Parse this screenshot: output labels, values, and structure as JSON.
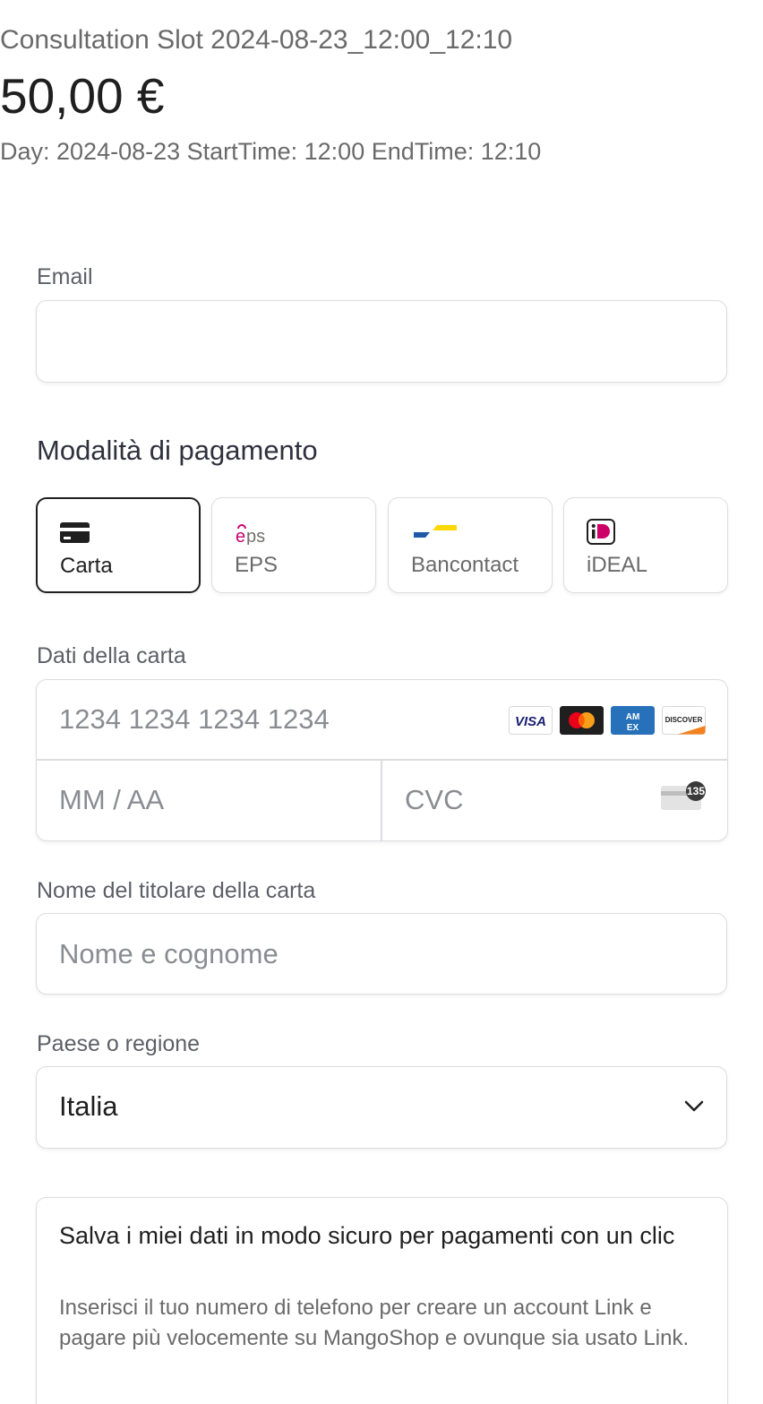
{
  "header": {
    "product_name": "Consultation Slot 2024-08-23_12:00_12:10",
    "price": "50,00 €",
    "description": "Day: 2024-08-23 StartTime: 12:00 EndTime: 12:10"
  },
  "email": {
    "label": "Email",
    "value": ""
  },
  "payment_method": {
    "title": "Modalità di pagamento",
    "selected": "Carta",
    "tabs": [
      {
        "label": "Carta",
        "icon": "card-icon"
      },
      {
        "label": "EPS",
        "icon": "eps-logo-icon"
      },
      {
        "label": "Bancontact",
        "icon": "bancontact-logo-icon"
      },
      {
        "label": "iDEAL",
        "icon": "ideal-logo-icon"
      }
    ]
  },
  "card": {
    "label": "Dati della carta",
    "number_placeholder": "1234 1234 1234 1234",
    "expiry_placeholder": "MM / AA",
    "cvc_placeholder": "CVC",
    "brands": [
      "VISA",
      "mastercard",
      "AMEX",
      "DISCOVER"
    ],
    "cvc_hint": "135"
  },
  "cardholder": {
    "label": "Nome del titolare della carta",
    "placeholder": "Nome e cognome"
  },
  "country": {
    "label": "Paese o regione",
    "value": "Italia"
  },
  "link": {
    "title": "Salva i miei dati in modo sicuro per pagamenti con un clic",
    "description": "Inserisci il tuo numero di telefono per creare un account Link e pagare più velocemente su MangoShop e ovunque sia usato Link."
  },
  "colors": {
    "eps": "#c8036f",
    "bancontact_blue": "#1e5aa8",
    "bancontact_yellow": "#ffd800",
    "ideal": "#cc0066",
    "visa": "#1a1f71",
    "amex": "#2671b9",
    "discover": "#f48120"
  }
}
